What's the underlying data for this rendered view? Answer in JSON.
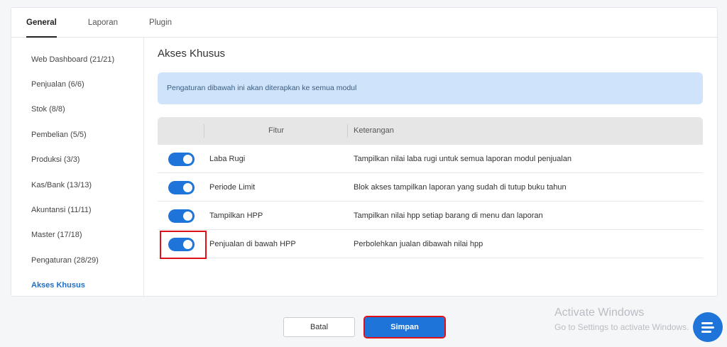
{
  "tabs": [
    "General",
    "Laporan",
    "Plugin"
  ],
  "sidebar": {
    "items": [
      {
        "label": "Web Dashboard (21/21)"
      },
      {
        "label": "Penjualan (6/6)"
      },
      {
        "label": "Stok (8/8)"
      },
      {
        "label": "Pembelian (5/5)"
      },
      {
        "label": "Produksi (3/3)"
      },
      {
        "label": "Kas/Bank (13/13)"
      },
      {
        "label": "Akuntansi (11/11)"
      },
      {
        "label": "Master (17/18)"
      },
      {
        "label": "Pengaturan (28/29)"
      },
      {
        "label": "Akses Khusus"
      }
    ]
  },
  "main": {
    "title": "Akses Khusus",
    "info": "Pengaturan dibawah ini akan diterapkan ke semua modul",
    "table": {
      "headers": {
        "fitur": "Fitur",
        "keterangan": "Keterangan"
      },
      "rows": [
        {
          "name": "Laba Rugi",
          "desc": "Tampilkan nilai laba rugi untuk semua laporan modul penjualan"
        },
        {
          "name": "Periode Limit",
          "desc": "Blok akses tampilkan laporan yang sudah di tutup buku tahun"
        },
        {
          "name": "Tampilkan HPP",
          "desc": "Tampilkan nilai hpp setiap barang di menu dan laporan"
        },
        {
          "name": "Penjualan di bawah HPP",
          "desc": "Perbolehkan jualan dibawah nilai hpp"
        }
      ]
    }
  },
  "footer": {
    "cancel_label": "Batal",
    "save_label": "Simpan"
  },
  "watermark": {
    "line1": "Activate Windows",
    "line2": "Go to Settings to activate Windows."
  },
  "colors": {
    "accent": "#1e74d8",
    "highlight": "#e0101b",
    "info_bg": "#cfe4fb"
  },
  "icons": {
    "chat": "chat-bubble-icon"
  }
}
